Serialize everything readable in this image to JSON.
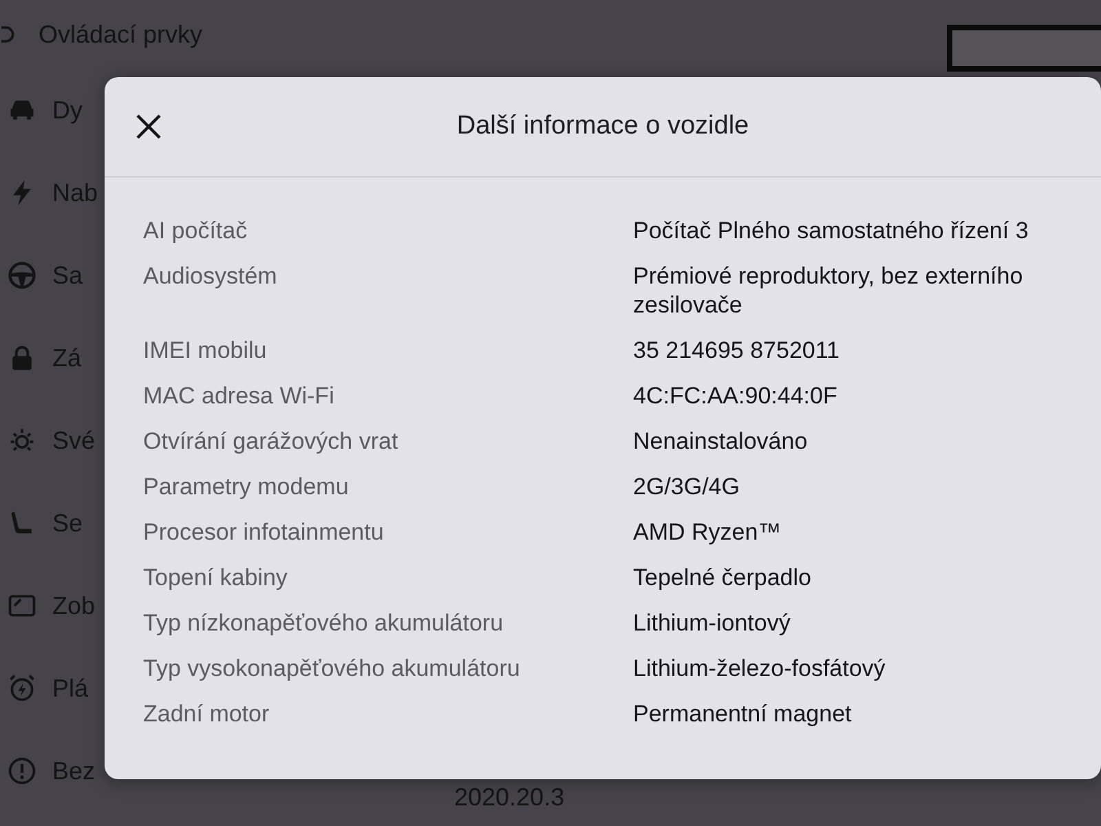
{
  "background_screen": {
    "menu": {
      "items": [
        {
          "label": "Ovládací prvky"
        },
        {
          "label": "Dy"
        },
        {
          "label": "Nab"
        },
        {
          "label": "Sa"
        },
        {
          "label": "Zá"
        },
        {
          "label": "Své"
        },
        {
          "label": "Se"
        },
        {
          "label": "Zob"
        },
        {
          "label": "Plá"
        },
        {
          "label": "Bez"
        }
      ]
    },
    "version": "2020.20.3"
  },
  "dialog": {
    "title": "Další informace o vozidle",
    "rows": [
      {
        "label": "AI počítač",
        "value": "Počítač Plného samostatného řízení 3"
      },
      {
        "label": "Audiosystém",
        "value": "Prémiové reproduktory, bez externího zesilovače"
      },
      {
        "label": "IMEI mobilu",
        "value": "35 214695 8752011"
      },
      {
        "label": "MAC adresa Wi-Fi",
        "value": "4C:FC:AA:90:44:0F"
      },
      {
        "label": "Otvírání garážových vrat",
        "value": "Nenainstalováno"
      },
      {
        "label": "Parametry modemu",
        "value": "2G/3G/4G"
      },
      {
        "label": "Procesor infotainmentu",
        "value": "AMD Ryzen™"
      },
      {
        "label": "Topení kabiny",
        "value": "Tepelné čerpadlo"
      },
      {
        "label": "Typ nízkonapěťového akumulátoru",
        "value": "Lithium-iontový"
      },
      {
        "label": "Typ vysokonapěťového akumulátoru",
        "value": "Lithium-železo-fosfátový"
      },
      {
        "label": "Zadní motor",
        "value": "Permanentní magnet"
      }
    ]
  }
}
